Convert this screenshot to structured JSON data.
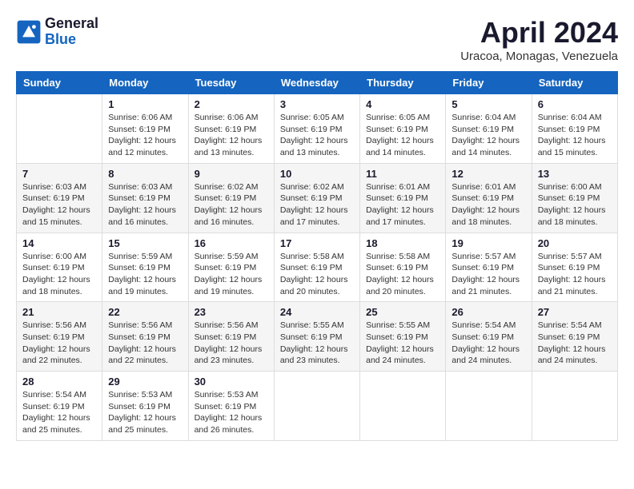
{
  "header": {
    "logo_general": "General",
    "logo_blue": "Blue",
    "month_title": "April 2024",
    "subtitle": "Uracoa, Monagas, Venezuela"
  },
  "calendar": {
    "days_of_week": [
      "Sunday",
      "Monday",
      "Tuesday",
      "Wednesday",
      "Thursday",
      "Friday",
      "Saturday"
    ],
    "weeks": [
      [
        {
          "day": "",
          "info": ""
        },
        {
          "day": "1",
          "info": "Sunrise: 6:06 AM\nSunset: 6:19 PM\nDaylight: 12 hours\nand 12 minutes."
        },
        {
          "day": "2",
          "info": "Sunrise: 6:06 AM\nSunset: 6:19 PM\nDaylight: 12 hours\nand 13 minutes."
        },
        {
          "day": "3",
          "info": "Sunrise: 6:05 AM\nSunset: 6:19 PM\nDaylight: 12 hours\nand 13 minutes."
        },
        {
          "day": "4",
          "info": "Sunrise: 6:05 AM\nSunset: 6:19 PM\nDaylight: 12 hours\nand 14 minutes."
        },
        {
          "day": "5",
          "info": "Sunrise: 6:04 AM\nSunset: 6:19 PM\nDaylight: 12 hours\nand 14 minutes."
        },
        {
          "day": "6",
          "info": "Sunrise: 6:04 AM\nSunset: 6:19 PM\nDaylight: 12 hours\nand 15 minutes."
        }
      ],
      [
        {
          "day": "7",
          "info": "Sunrise: 6:03 AM\nSunset: 6:19 PM\nDaylight: 12 hours\nand 15 minutes."
        },
        {
          "day": "8",
          "info": "Sunrise: 6:03 AM\nSunset: 6:19 PM\nDaylight: 12 hours\nand 16 minutes."
        },
        {
          "day": "9",
          "info": "Sunrise: 6:02 AM\nSunset: 6:19 PM\nDaylight: 12 hours\nand 16 minutes."
        },
        {
          "day": "10",
          "info": "Sunrise: 6:02 AM\nSunset: 6:19 PM\nDaylight: 12 hours\nand 17 minutes."
        },
        {
          "day": "11",
          "info": "Sunrise: 6:01 AM\nSunset: 6:19 PM\nDaylight: 12 hours\nand 17 minutes."
        },
        {
          "day": "12",
          "info": "Sunrise: 6:01 AM\nSunset: 6:19 PM\nDaylight: 12 hours\nand 18 minutes."
        },
        {
          "day": "13",
          "info": "Sunrise: 6:00 AM\nSunset: 6:19 PM\nDaylight: 12 hours\nand 18 minutes."
        }
      ],
      [
        {
          "day": "14",
          "info": "Sunrise: 6:00 AM\nSunset: 6:19 PM\nDaylight: 12 hours\nand 18 minutes."
        },
        {
          "day": "15",
          "info": "Sunrise: 5:59 AM\nSunset: 6:19 PM\nDaylight: 12 hours\nand 19 minutes."
        },
        {
          "day": "16",
          "info": "Sunrise: 5:59 AM\nSunset: 6:19 PM\nDaylight: 12 hours\nand 19 minutes."
        },
        {
          "day": "17",
          "info": "Sunrise: 5:58 AM\nSunset: 6:19 PM\nDaylight: 12 hours\nand 20 minutes."
        },
        {
          "day": "18",
          "info": "Sunrise: 5:58 AM\nSunset: 6:19 PM\nDaylight: 12 hours\nand 20 minutes."
        },
        {
          "day": "19",
          "info": "Sunrise: 5:57 AM\nSunset: 6:19 PM\nDaylight: 12 hours\nand 21 minutes."
        },
        {
          "day": "20",
          "info": "Sunrise: 5:57 AM\nSunset: 6:19 PM\nDaylight: 12 hours\nand 21 minutes."
        }
      ],
      [
        {
          "day": "21",
          "info": "Sunrise: 5:56 AM\nSunset: 6:19 PM\nDaylight: 12 hours\nand 22 minutes."
        },
        {
          "day": "22",
          "info": "Sunrise: 5:56 AM\nSunset: 6:19 PM\nDaylight: 12 hours\nand 22 minutes."
        },
        {
          "day": "23",
          "info": "Sunrise: 5:56 AM\nSunset: 6:19 PM\nDaylight: 12 hours\nand 23 minutes."
        },
        {
          "day": "24",
          "info": "Sunrise: 5:55 AM\nSunset: 6:19 PM\nDaylight: 12 hours\nand 23 minutes."
        },
        {
          "day": "25",
          "info": "Sunrise: 5:55 AM\nSunset: 6:19 PM\nDaylight: 12 hours\nand 24 minutes."
        },
        {
          "day": "26",
          "info": "Sunrise: 5:54 AM\nSunset: 6:19 PM\nDaylight: 12 hours\nand 24 minutes."
        },
        {
          "day": "27",
          "info": "Sunrise: 5:54 AM\nSunset: 6:19 PM\nDaylight: 12 hours\nand 24 minutes."
        }
      ],
      [
        {
          "day": "28",
          "info": "Sunrise: 5:54 AM\nSunset: 6:19 PM\nDaylight: 12 hours\nand 25 minutes."
        },
        {
          "day": "29",
          "info": "Sunrise: 5:53 AM\nSunset: 6:19 PM\nDaylight: 12 hours\nand 25 minutes."
        },
        {
          "day": "30",
          "info": "Sunrise: 5:53 AM\nSunset: 6:19 PM\nDaylight: 12 hours\nand 26 minutes."
        },
        {
          "day": "",
          "info": ""
        },
        {
          "day": "",
          "info": ""
        },
        {
          "day": "",
          "info": ""
        },
        {
          "day": "",
          "info": ""
        }
      ]
    ]
  }
}
